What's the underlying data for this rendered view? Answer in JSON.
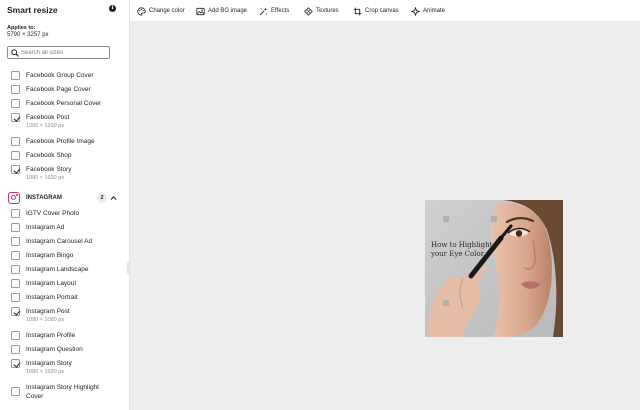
{
  "sidebar": {
    "title": "Smart resize",
    "applies_label": "Applies to:",
    "dimensions": "5790 × 3257 px",
    "search": {
      "placeholder": "Search all sizes",
      "value": ""
    },
    "facebook_items": [
      {
        "label": "Facebook Group Cover",
        "checked": false,
        "sub": ""
      },
      {
        "label": "Facebook Page Cover",
        "checked": false,
        "sub": ""
      },
      {
        "label": "Facebook Personal Cover",
        "checked": false,
        "sub": ""
      },
      {
        "label": "Facebook Post",
        "checked": true,
        "sub": "1200 × 1200 px"
      },
      {
        "label": "Facebook Profile Image",
        "checked": false,
        "sub": ""
      },
      {
        "label": "Facebook Shop",
        "checked": false,
        "sub": ""
      },
      {
        "label": "Facebook Story",
        "checked": true,
        "sub": "1080 × 1920 px"
      }
    ],
    "instagram_section": {
      "title": "INSTAGRAM",
      "count": "2",
      "expanded": true
    },
    "instagram_items": [
      {
        "label": "IGTV Cover Photo",
        "checked": false,
        "sub": ""
      },
      {
        "label": "Instagram Ad",
        "checked": false,
        "sub": ""
      },
      {
        "label": "Instagram Carousel Ad",
        "checked": false,
        "sub": ""
      },
      {
        "label": "Instagram Bingo",
        "checked": false,
        "sub": ""
      },
      {
        "label": "Instagram Landscape",
        "checked": false,
        "sub": ""
      },
      {
        "label": "Instagram Layout",
        "checked": false,
        "sub": ""
      },
      {
        "label": "Instagram Portrait",
        "checked": false,
        "sub": ""
      },
      {
        "label": "Instagram Post",
        "checked": true,
        "sub": "1080 × 1080 px"
      },
      {
        "label": "Instagram Profile",
        "checked": false,
        "sub": ""
      },
      {
        "label": "Instagram Question",
        "checked": false,
        "sub": ""
      },
      {
        "label": "Instagram Story",
        "checked": true,
        "sub": "1080 × 1920 px"
      },
      {
        "label": "Instagram Story Highlight Cover",
        "checked": false,
        "sub": ""
      }
    ]
  },
  "toolbar": {
    "items": [
      {
        "label": "Change color",
        "icon": "palette-icon"
      },
      {
        "label": "Add BG image",
        "icon": "image-icon"
      },
      {
        "label": "Effects",
        "icon": "sparkle-icon"
      },
      {
        "label": "Textures",
        "icon": "texture-icon"
      },
      {
        "label": "Crop canvas",
        "icon": "crop-icon"
      },
      {
        "label": "Animate",
        "icon": "animate-icon"
      }
    ]
  },
  "design": {
    "headline": "How to Highlight your Eye Color"
  },
  "colors": {
    "accent": "#d6306b",
    "canvas_bg": "#ededee",
    "text": "#1f1f23"
  }
}
